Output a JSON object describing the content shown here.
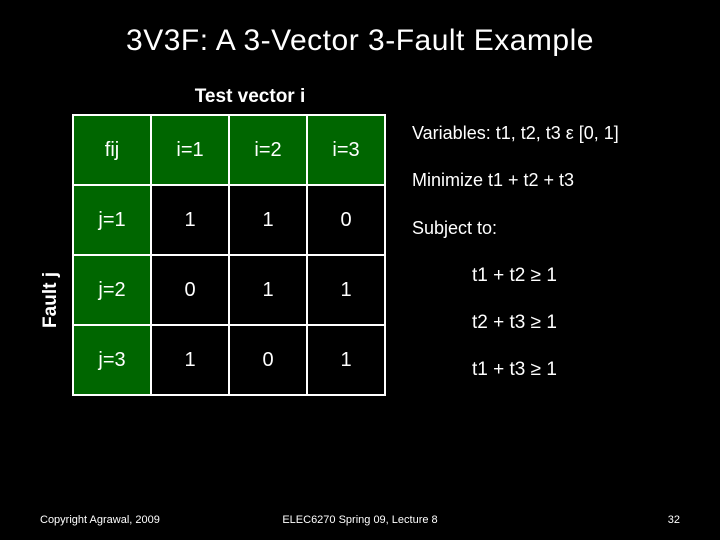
{
  "title": "3V3F: A 3-Vector 3-Fault Example",
  "caption_top": "Test vector i",
  "ylabel": "Fault j",
  "table": {
    "corner": "fij",
    "col_headers": [
      "i=1",
      "i=2",
      "i=3"
    ],
    "rows": [
      {
        "label": "j=1",
        "cells": [
          "1",
          "1",
          "0"
        ]
      },
      {
        "label": "j=2",
        "cells": [
          "0",
          "1",
          "1"
        ]
      },
      {
        "label": "j=3",
        "cells": [
          "1",
          "0",
          "1"
        ]
      }
    ]
  },
  "lines": {
    "vars": "Variables: t1, t2, t3 ε [0, 1]",
    "min": "Minimize t1 + t2 + t3",
    "subj": "Subject to:"
  },
  "constraints": [
    "t1 + t2 ≥ 1",
    "t2 + t3 ≥ 1",
    "t1 + t3 ≥ 1"
  ],
  "footer": {
    "left": "Copyright Agrawal, 2009",
    "mid": "ELEC6270 Spring 09, Lecture 8",
    "page": "32"
  },
  "chart_data": {
    "type": "table",
    "title": "3V3F: A 3-Vector 3-Fault Example",
    "xlabel": "Test vector i",
    "ylabel": "Fault j",
    "categories": [
      "i=1",
      "i=2",
      "i=3"
    ],
    "series": [
      {
        "name": "j=1",
        "values": [
          1,
          1,
          0
        ]
      },
      {
        "name": "j=2",
        "values": [
          0,
          1,
          1
        ]
      },
      {
        "name": "j=3",
        "values": [
          1,
          0,
          1
        ]
      }
    ]
  }
}
